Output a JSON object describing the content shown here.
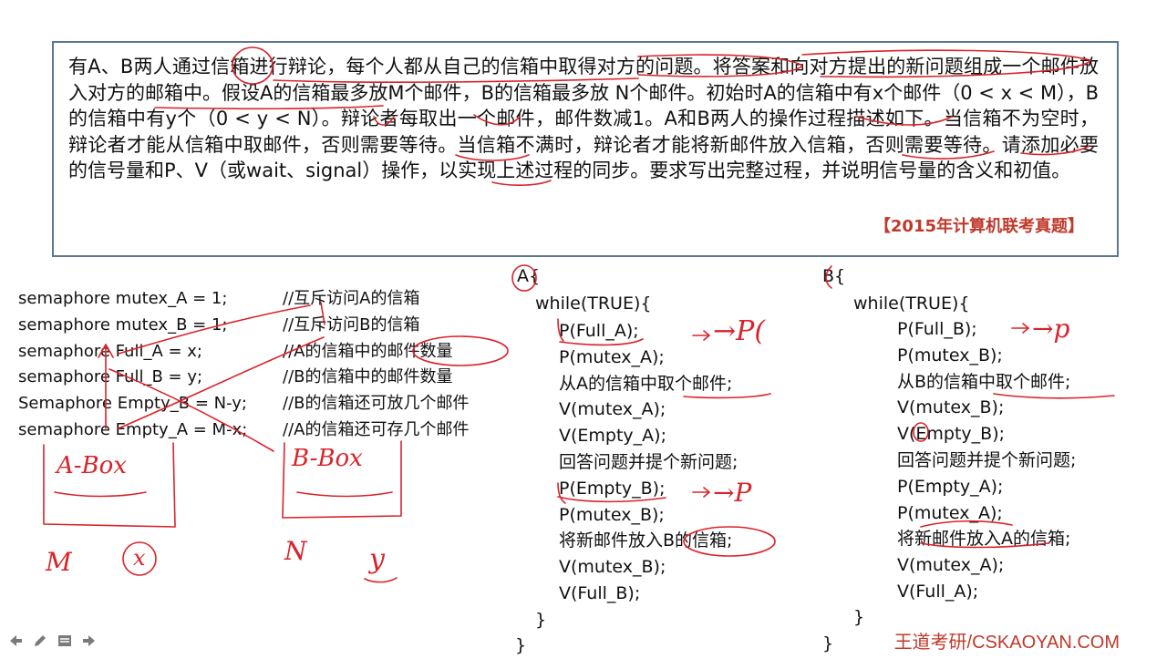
{
  "problem": {
    "text": "有A、B两人通过信箱进行辩论，每个人都从自己的信箱中取得对方的问题。将答案和向对方提出的新问题组成一个邮件放入对方的邮箱中。假设A的信箱最多放M个邮件，B的信箱最多放 N个邮件。初始时A的信箱中有x个邮件（0 < x < M），B的信箱中有y个（0 < y < N）。辩论者每取出一个邮件，邮件数减1。A和B两人的操作过程描述如下。当信箱不为空时，辩论者才能从信箱中取邮件，否则需要等待。当信箱不满时，辩论者才能将新邮件放入信箱，否则需要等待。请添加必要的信号量和P、V（或wait、signal）操作，以实现上述过程的同步。要求写出完整过程，并说明信号量的含义和初值。",
    "source": "【2015年计算机联考真题】"
  },
  "semaphores": [
    {
      "code": "semaphore mutex_A = 1;",
      "comment": "//互斥访问A的信箱"
    },
    {
      "code": "semaphore mutex_B = 1;",
      "comment": "//互斥访问B的信箱"
    },
    {
      "code": "semaphore Full_A = x;",
      "comment": "//A的信箱中的邮件数量"
    },
    {
      "code": "semaphore Full_B = y;",
      "comment": "//B的信箱中的邮件数量"
    },
    {
      "code": "Semaphore Empty_B = N-y;",
      "comment": "//B的信箱还可放几个邮件"
    },
    {
      "code": "semaphore Empty_A = M-x;",
      "comment": "//A的信箱还可存几个邮件"
    }
  ],
  "process_a": {
    "header": "A{",
    "loop": "while(TRUE){",
    "lines": [
      "P(Full_A);",
      "P(mutex_A);",
      "从A的信箱中取个邮件;",
      "V(mutex_A);",
      "V(Empty_A);",
      "回答问题并提个新问题;",
      "P(Empty_B);",
      "P(mutex_B);",
      "将新邮件放入B的信箱;",
      "V(mutex_B);",
      "V(Full_B);"
    ],
    "loop_close": "}",
    "close": "}"
  },
  "process_b": {
    "header": "B{",
    "loop": "while(TRUE){",
    "lines": [
      "P(Full_B);",
      "P(mutex_B);",
      "从B的信箱中取个邮件;",
      "V(mutex_B);",
      "V(Empty_B);",
      "回答问题并提个新问题;",
      "P(Empty_A);",
      "P(mutex_A);",
      "将新邮件放入A的信箱;",
      "V(mutex_A);",
      "V(Full_A);"
    ],
    "loop_close": "}",
    "close": "}"
  },
  "annotations": {
    "a_box": "A-Box",
    "b_box": "B-Box",
    "m": "M",
    "x": "x",
    "n": "N",
    "y": "y",
    "arrow_p1": "→P(",
    "arrow_p2": "→P",
    "arrow_p3": "→p"
  },
  "watermark": "王道考研/CSKAOYAN.COM",
  "toolbar": {
    "icons": [
      "arrow-left-icon",
      "pen-icon",
      "notes-icon",
      "arrow-right-icon"
    ]
  },
  "colors": {
    "ink": "#d9232a",
    "box_border": "#5a7893",
    "brand": "#c0392b"
  }
}
